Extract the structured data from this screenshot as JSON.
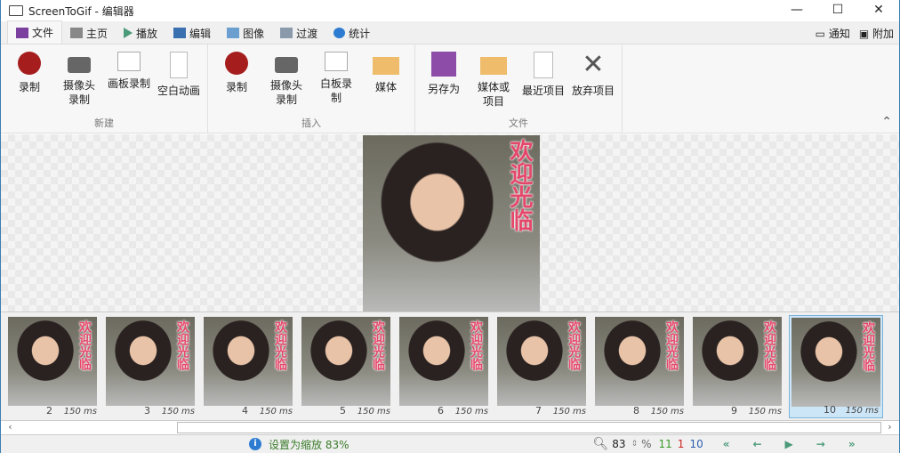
{
  "window": {
    "title": "ScreenToGif - 编辑器",
    "min": "—",
    "max": "☐",
    "close": "✕"
  },
  "tabs": [
    {
      "label": "文件",
      "color": "#7b3fa0"
    },
    {
      "label": "主页",
      "color": "#888"
    },
    {
      "label": "播放",
      "color": "#4a9a7a"
    },
    {
      "label": "编辑",
      "color": "#3a6fb0"
    },
    {
      "label": "图像",
      "color": "#6a9fd0"
    },
    {
      "label": "过渡",
      "color": "#8a9aaa"
    },
    {
      "label": "统计",
      "color": "#2d7cd1"
    }
  ],
  "tabs_right": {
    "notify": "通知",
    "extras": "附加"
  },
  "ribbon": {
    "groups": [
      {
        "label": "新建",
        "items": [
          "录制",
          "摄像头录制",
          "画板录制",
          "空白动画"
        ]
      },
      {
        "label": "插入",
        "items": [
          "录制",
          "摄像头录制",
          "白板录制",
          "媒体"
        ]
      },
      {
        "label": "文件",
        "items": [
          "另存为",
          "媒体或项目",
          "最近项目",
          "放弃项目"
        ]
      }
    ]
  },
  "image_caption": "欢迎光临",
  "frames": [
    {
      "n": "2",
      "ms": "150 ms"
    },
    {
      "n": "3",
      "ms": "150 ms"
    },
    {
      "n": "4",
      "ms": "150 ms"
    },
    {
      "n": "5",
      "ms": "150 ms"
    },
    {
      "n": "6",
      "ms": "150 ms"
    },
    {
      "n": "7",
      "ms": "150 ms"
    },
    {
      "n": "8",
      "ms": "150 ms"
    },
    {
      "n": "9",
      "ms": "150 ms"
    },
    {
      "n": "10",
      "ms": "150 ms",
      "selected": true
    }
  ],
  "status": {
    "message": "设置为缩放 83%",
    "zoom": "83",
    "percent": "%",
    "total": "11",
    "selected_count": "1",
    "current": "10"
  }
}
